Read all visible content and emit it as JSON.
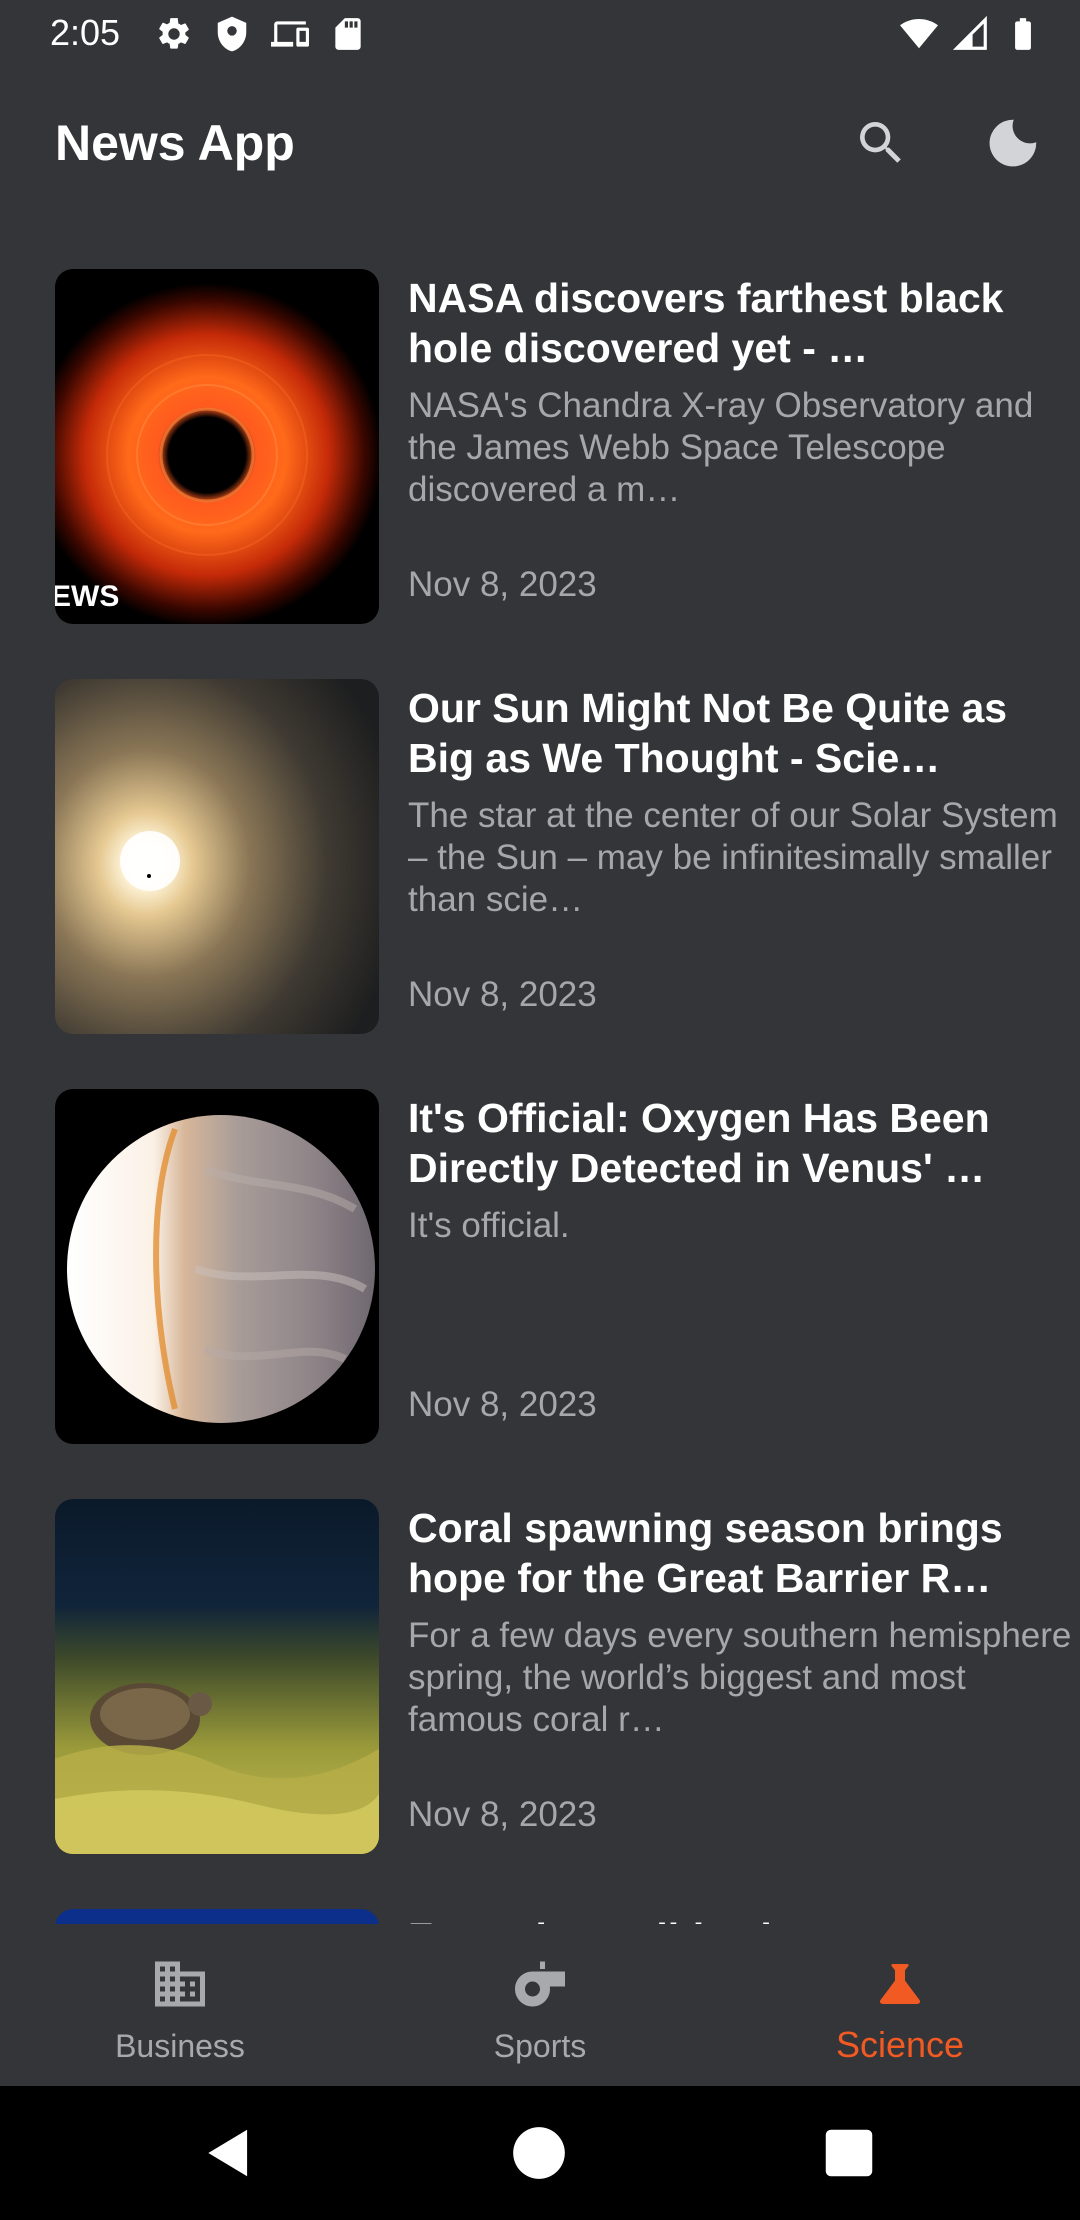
{
  "status_bar": {
    "time": "2:05",
    "left_icons": [
      "settings-icon",
      "shield-icon",
      "devices-icon",
      "sd-card-icon"
    ],
    "right_icons": [
      "wifi-icon",
      "signal-icon",
      "battery-icon"
    ]
  },
  "app_bar": {
    "title": "News App",
    "actions": [
      "search-icon",
      "dark-mode-icon"
    ]
  },
  "articles": [
    {
      "title": "NASA discovers farthest black hole discovered yet - …",
      "description": "NASA's Chandra X-ray Observatory and the James Webb Space Telescope discovered a m…",
      "date": "Nov 8, 2023",
      "image_caption": "EWS"
    },
    {
      "title": "Our Sun Might Not Be Quite as Big as We Thought - Scie…",
      "description": "The star at the center of our Solar System – the Sun – may be infinitesimally smaller than scie…",
      "date": "Nov 8, 2023"
    },
    {
      "title": "It's Official: Oxygen Has Been Directly Detected in Venus' …",
      "description": "It's official.",
      "date": "Nov 8, 2023"
    },
    {
      "title": "Coral spawning season brings hope for the Great Barrier R…",
      "description": "For a few days every southern hemisphere spring, the world’s biggest and most famous coral r…",
      "date": "Nov 8, 2023"
    },
    {
      "title": "Formula Euclid Tele…",
      "description": "",
      "date": ""
    }
  ],
  "bottom_nav": {
    "items": [
      {
        "label": "Business",
        "icon": "building-icon",
        "active": false
      },
      {
        "label": "Sports",
        "icon": "whistle-icon",
        "active": false
      },
      {
        "label": "Science",
        "icon": "flask-icon",
        "active": true
      }
    ],
    "active_color": "#f25a24"
  },
  "system_nav": [
    "back-icon",
    "home-icon",
    "recents-icon"
  ]
}
